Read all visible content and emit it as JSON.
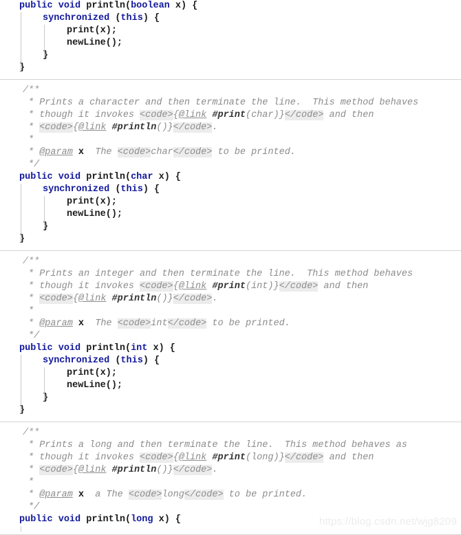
{
  "editor": {
    "language": "java",
    "background": "#ffffff",
    "keyword_color": "#12199b",
    "comment_color": "#8c8c8c",
    "code_tag_bg": "#ececec",
    "separator_color": "#d4d4d4",
    "indent_guide_color": "#c8c8c8"
  },
  "watermark": {
    "text": "https://blog.csdn.net/wjg8209",
    "color": "#ececed"
  },
  "blocks": [
    {
      "id": "println-boolean",
      "has_javadoc": false,
      "code": [
        {
          "indent": 0,
          "tokens": [
            {
              "t": "public",
              "k": "kw"
            },
            {
              "t": " ",
              "k": "plain"
            },
            {
              "t": "void",
              "k": "kw"
            },
            {
              "t": " ",
              "k": "plain"
            },
            {
              "t": "println",
              "k": "ident"
            },
            {
              "t": "(",
              "k": "punc"
            },
            {
              "t": "boolean",
              "k": "kw"
            },
            {
              "t": " ",
              "k": "plain"
            },
            {
              "t": "x",
              "k": "ident"
            },
            {
              "t": ") {",
              "k": "punc"
            }
          ]
        },
        {
          "indent": 1,
          "tokens": [
            {
              "t": "synchronized",
              "k": "kw"
            },
            {
              "t": " (",
              "k": "punc"
            },
            {
              "t": "this",
              "k": "kw"
            },
            {
              "t": ") {",
              "k": "punc"
            }
          ]
        },
        {
          "indent": 2,
          "tokens": [
            {
              "t": "print",
              "k": "ident"
            },
            {
              "t": "(",
              "k": "punc"
            },
            {
              "t": "x",
              "k": "ident"
            },
            {
              "t": ");",
              "k": "punc"
            }
          ]
        },
        {
          "indent": 2,
          "tokens": [
            {
              "t": "newLine",
              "k": "ident"
            },
            {
              "t": "();",
              "k": "punc"
            }
          ]
        },
        {
          "indent": 1,
          "tokens": [
            {
              "t": "}",
              "k": "punc"
            }
          ]
        },
        {
          "indent": 0,
          "tokens": [
            {
              "t": "}",
              "k": "punc"
            }
          ]
        }
      ]
    },
    {
      "id": "println-char",
      "has_javadoc": true,
      "javadoc": [
        {
          "pad": "jd",
          "tokens": [
            {
              "t": "/**",
              "k": "cmt-slash"
            }
          ]
        },
        {
          "pad": "jd1",
          "tokens": [
            {
              "t": "* Prints a character and then terminate the line.  This method behaves",
              "k": "cmt"
            }
          ]
        },
        {
          "pad": "jd1",
          "tokens": [
            {
              "t": "* though it invokes ",
              "k": "cmt"
            },
            {
              "t": "<code>",
              "k": "tag"
            },
            {
              "t": "{",
              "k": "cmt"
            },
            {
              "t": "@link",
              "k": "link"
            },
            {
              "t": " ",
              "k": "cmt"
            },
            {
              "t": "#print",
              "k": "ref"
            },
            {
              "t": "(char)}",
              "k": "refargs"
            },
            {
              "t": "</code>",
              "k": "tag"
            },
            {
              "t": " and then",
              "k": "cmt"
            }
          ]
        },
        {
          "pad": "jd1",
          "tokens": [
            {
              "t": "* ",
              "k": "cmt"
            },
            {
              "t": "<code>",
              "k": "tag"
            },
            {
              "t": "{",
              "k": "cmt"
            },
            {
              "t": "@link",
              "k": "link"
            },
            {
              "t": " ",
              "k": "cmt"
            },
            {
              "t": "#println",
              "k": "ref"
            },
            {
              "t": "()}",
              "k": "refargs"
            },
            {
              "t": "</code>",
              "k": "tag"
            },
            {
              "t": ".",
              "k": "cmt"
            }
          ]
        },
        {
          "pad": "jd1",
          "tokens": [
            {
              "t": "*",
              "k": "cmt"
            }
          ]
        },
        {
          "pad": "jd1",
          "tokens": [
            {
              "t": "* ",
              "k": "cmt"
            },
            {
              "t": "@param",
              "k": "paramtag"
            },
            {
              "t": " ",
              "k": "cmt"
            },
            {
              "t": "x",
              "k": "paramname"
            },
            {
              "t": "  The ",
              "k": "cmt"
            },
            {
              "t": "<code>",
              "k": "tag"
            },
            {
              "t": "char",
              "k": "cmt"
            },
            {
              "t": "</code>",
              "k": "tag"
            },
            {
              "t": " to be printed.",
              "k": "cmt"
            }
          ]
        },
        {
          "pad": "jd1",
          "tokens": [
            {
              "t": "*/",
              "k": "cmt"
            }
          ]
        }
      ],
      "code": [
        {
          "indent": 0,
          "tokens": [
            {
              "t": "public",
              "k": "kw"
            },
            {
              "t": " ",
              "k": "plain"
            },
            {
              "t": "void",
              "k": "kw"
            },
            {
              "t": " ",
              "k": "plain"
            },
            {
              "t": "println",
              "k": "ident"
            },
            {
              "t": "(",
              "k": "punc"
            },
            {
              "t": "char",
              "k": "kw"
            },
            {
              "t": " ",
              "k": "plain"
            },
            {
              "t": "x",
              "k": "ident"
            },
            {
              "t": ") {",
              "k": "punc"
            }
          ]
        },
        {
          "indent": 1,
          "tokens": [
            {
              "t": "synchronized",
              "k": "kw"
            },
            {
              "t": " (",
              "k": "punc"
            },
            {
              "t": "this",
              "k": "kw"
            },
            {
              "t": ") {",
              "k": "punc"
            }
          ]
        },
        {
          "indent": 2,
          "tokens": [
            {
              "t": "print",
              "k": "ident"
            },
            {
              "t": "(",
              "k": "punc"
            },
            {
              "t": "x",
              "k": "ident"
            },
            {
              "t": ");",
              "k": "punc"
            }
          ]
        },
        {
          "indent": 2,
          "tokens": [
            {
              "t": "newLine",
              "k": "ident"
            },
            {
              "t": "();",
              "k": "punc"
            }
          ]
        },
        {
          "indent": 1,
          "tokens": [
            {
              "t": "}",
              "k": "punc"
            }
          ]
        },
        {
          "indent": 0,
          "tokens": [
            {
              "t": "}",
              "k": "punc"
            }
          ]
        }
      ]
    },
    {
      "id": "println-int",
      "has_javadoc": true,
      "javadoc": [
        {
          "pad": "jd",
          "tokens": [
            {
              "t": "/**",
              "k": "cmt-slash"
            }
          ]
        },
        {
          "pad": "jd1",
          "tokens": [
            {
              "t": "* Prints an integer and then terminate the line.  This method behaves",
              "k": "cmt"
            }
          ]
        },
        {
          "pad": "jd1",
          "tokens": [
            {
              "t": "* though it invokes ",
              "k": "cmt"
            },
            {
              "t": "<code>",
              "k": "tag"
            },
            {
              "t": "{",
              "k": "cmt"
            },
            {
              "t": "@link",
              "k": "link"
            },
            {
              "t": " ",
              "k": "cmt"
            },
            {
              "t": "#print",
              "k": "ref"
            },
            {
              "t": "(int)}",
              "k": "refargs"
            },
            {
              "t": "</code>",
              "k": "tag"
            },
            {
              "t": " and then",
              "k": "cmt"
            }
          ]
        },
        {
          "pad": "jd1",
          "tokens": [
            {
              "t": "* ",
              "k": "cmt"
            },
            {
              "t": "<code>",
              "k": "tag"
            },
            {
              "t": "{",
              "k": "cmt"
            },
            {
              "t": "@link",
              "k": "link"
            },
            {
              "t": " ",
              "k": "cmt"
            },
            {
              "t": "#println",
              "k": "ref"
            },
            {
              "t": "()}",
              "k": "refargs"
            },
            {
              "t": "</code>",
              "k": "tag"
            },
            {
              "t": ".",
              "k": "cmt"
            }
          ]
        },
        {
          "pad": "jd1",
          "tokens": [
            {
              "t": "*",
              "k": "cmt"
            }
          ]
        },
        {
          "pad": "jd1",
          "tokens": [
            {
              "t": "* ",
              "k": "cmt"
            },
            {
              "t": "@param",
              "k": "paramtag"
            },
            {
              "t": " ",
              "k": "cmt"
            },
            {
              "t": "x",
              "k": "paramname"
            },
            {
              "t": "  The ",
              "k": "cmt"
            },
            {
              "t": "<code>",
              "k": "tag"
            },
            {
              "t": "int",
              "k": "cmt"
            },
            {
              "t": "</code>",
              "k": "tag"
            },
            {
              "t": " to be printed.",
              "k": "cmt"
            }
          ]
        },
        {
          "pad": "jd1",
          "tokens": [
            {
              "t": "*/",
              "k": "cmt"
            }
          ]
        }
      ],
      "code": [
        {
          "indent": 0,
          "tokens": [
            {
              "t": "public",
              "k": "kw"
            },
            {
              "t": " ",
              "k": "plain"
            },
            {
              "t": "void",
              "k": "kw"
            },
            {
              "t": " ",
              "k": "plain"
            },
            {
              "t": "println",
              "k": "ident"
            },
            {
              "t": "(",
              "k": "punc"
            },
            {
              "t": "int",
              "k": "kw"
            },
            {
              "t": " ",
              "k": "plain"
            },
            {
              "t": "x",
              "k": "ident"
            },
            {
              "t": ") {",
              "k": "punc"
            }
          ]
        },
        {
          "indent": 1,
          "tokens": [
            {
              "t": "synchronized",
              "k": "kw"
            },
            {
              "t": " (",
              "k": "punc"
            },
            {
              "t": "this",
              "k": "kw"
            },
            {
              "t": ") {",
              "k": "punc"
            }
          ]
        },
        {
          "indent": 2,
          "tokens": [
            {
              "t": "print",
              "k": "ident"
            },
            {
              "t": "(",
              "k": "punc"
            },
            {
              "t": "x",
              "k": "ident"
            },
            {
              "t": ");",
              "k": "punc"
            }
          ]
        },
        {
          "indent": 2,
          "tokens": [
            {
              "t": "newLine",
              "k": "ident"
            },
            {
              "t": "();",
              "k": "punc"
            }
          ]
        },
        {
          "indent": 1,
          "tokens": [
            {
              "t": "}",
              "k": "punc"
            }
          ]
        },
        {
          "indent": 0,
          "tokens": [
            {
              "t": "}",
              "k": "punc"
            }
          ]
        }
      ]
    },
    {
      "id": "println-long",
      "has_javadoc": true,
      "javadoc": [
        {
          "pad": "jd",
          "tokens": [
            {
              "t": "/**",
              "k": "cmt-slash"
            }
          ]
        },
        {
          "pad": "jd1",
          "tokens": [
            {
              "t": "* Prints a long and then terminate the line.  This method behaves as",
              "k": "cmt"
            }
          ]
        },
        {
          "pad": "jd1",
          "tokens": [
            {
              "t": "* though it invokes ",
              "k": "cmt"
            },
            {
              "t": "<code>",
              "k": "tag"
            },
            {
              "t": "{",
              "k": "cmt"
            },
            {
              "t": "@link",
              "k": "link"
            },
            {
              "t": " ",
              "k": "cmt"
            },
            {
              "t": "#print",
              "k": "ref"
            },
            {
              "t": "(long)}",
              "k": "refargs"
            },
            {
              "t": "</code>",
              "k": "tag"
            },
            {
              "t": " and then",
              "k": "cmt"
            }
          ]
        },
        {
          "pad": "jd1",
          "tokens": [
            {
              "t": "* ",
              "k": "cmt"
            },
            {
              "t": "<code>",
              "k": "tag"
            },
            {
              "t": "{",
              "k": "cmt"
            },
            {
              "t": "@link",
              "k": "link"
            },
            {
              "t": " ",
              "k": "cmt"
            },
            {
              "t": "#println",
              "k": "ref"
            },
            {
              "t": "()}",
              "k": "refargs"
            },
            {
              "t": "</code>",
              "k": "tag"
            },
            {
              "t": ".",
              "k": "cmt"
            }
          ]
        },
        {
          "pad": "jd1",
          "tokens": [
            {
              "t": "*",
              "k": "cmt"
            }
          ]
        },
        {
          "pad": "jd1",
          "tokens": [
            {
              "t": "* ",
              "k": "cmt"
            },
            {
              "t": "@param",
              "k": "paramtag"
            },
            {
              "t": " ",
              "k": "cmt"
            },
            {
              "t": "x",
              "k": "paramname"
            },
            {
              "t": "  a The ",
              "k": "cmt"
            },
            {
              "t": "<code>",
              "k": "tag"
            },
            {
              "t": "long",
              "k": "cmt"
            },
            {
              "t": "</code>",
              "k": "tag"
            },
            {
              "t": " to be printed.",
              "k": "cmt"
            }
          ]
        },
        {
          "pad": "jd1",
          "tokens": [
            {
              "t": "*/",
              "k": "cmt"
            }
          ]
        }
      ],
      "code": [
        {
          "indent": 0,
          "tokens": [
            {
              "t": "public",
              "k": "kw"
            },
            {
              "t": " ",
              "k": "plain"
            },
            {
              "t": "void",
              "k": "kw"
            },
            {
              "t": " ",
              "k": "plain"
            },
            {
              "t": "println",
              "k": "ident"
            },
            {
              "t": "(",
              "k": "punc"
            },
            {
              "t": "long",
              "k": "kw"
            },
            {
              "t": " ",
              "k": "plain"
            },
            {
              "t": "x",
              "k": "ident"
            },
            {
              "t": ") {",
              "k": "punc"
            }
          ]
        }
      ]
    }
  ]
}
